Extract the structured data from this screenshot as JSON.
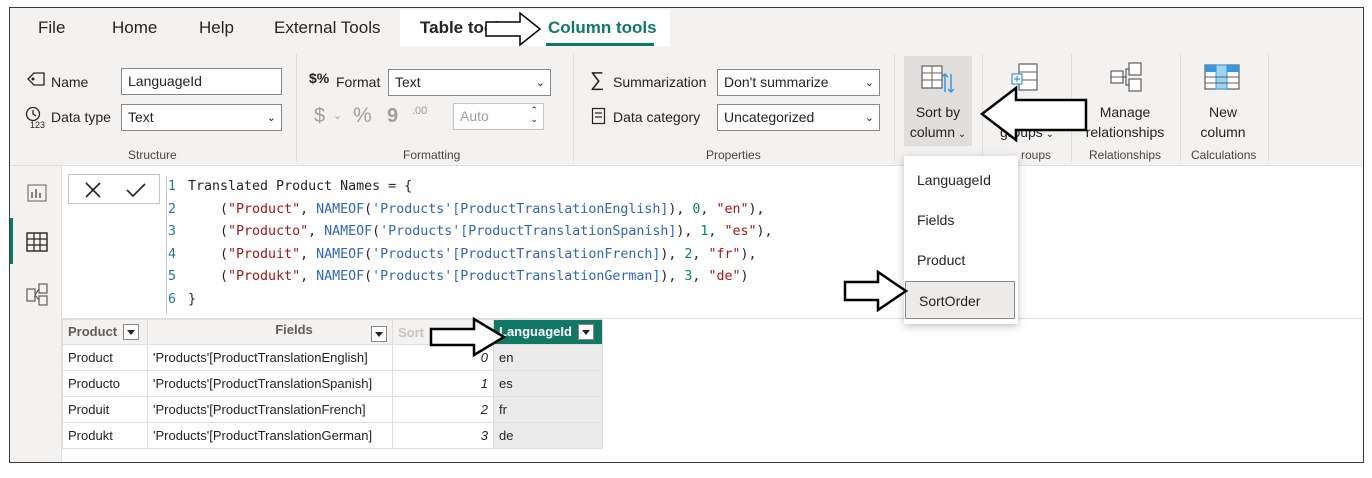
{
  "tabs": {
    "file": "File",
    "home": "Home",
    "help": "Help",
    "external_tools": "External Tools",
    "table_tools": "Table tools",
    "column_tools": "Column tools"
  },
  "structure": {
    "name_label": "Name",
    "name_value": "LanguageId",
    "datatype_label": "Data type",
    "datatype_value": "Text",
    "group_label": "Structure"
  },
  "formatting": {
    "format_label": "Format",
    "format_value": "Text",
    "currency_symbol": "$",
    "percent_symbol": "%",
    "comma_symbol": "9",
    "decimals_symbol": ".00",
    "auto_value": "Auto",
    "group_label": "Formatting"
  },
  "properties": {
    "summarization_label": "Summarization",
    "summarization_value": "Don't summarize",
    "category_label": "Data category",
    "category_value": "Uncategorized",
    "group_label": "Properties"
  },
  "sort_by": {
    "line1": "Sort by",
    "line2": "column"
  },
  "groups_btn": {
    "line2": "groups"
  },
  "groups_group_label": "roups",
  "manage_rel": {
    "line1": "Manage",
    "line2": "relationships",
    "group_label": "Relationships"
  },
  "new_column": {
    "line1": "New",
    "line2": "column",
    "group_label": "Calculations"
  },
  "dropdown_menu": [
    "LanguageId",
    "Fields",
    "Product",
    "SortOrder"
  ],
  "formula": {
    "line_numbers": [
      "1",
      "2",
      "3",
      "4",
      "5",
      "6"
    ],
    "line1": "Translated Product Names = {",
    "rows": [
      {
        "str1": "\"Product\"",
        "fn": "NAMEOF",
        "arg": "'Products'[ProductTranslationEnglish]",
        "num": "0",
        "str2": "\"en\"",
        "end": "),"
      },
      {
        "str1": "\"Producto\"",
        "fn": "NAMEOF",
        "arg": "'Products'[ProductTranslationSpanish]",
        "num": "1",
        "str2": "\"es\"",
        "end": "),"
      },
      {
        "str1": "\"Produit\"",
        "fn": "NAMEOF",
        "arg": "'Products'[ProductTranslationFrench]",
        "num": "2",
        "str2": "\"fr\"",
        "end": "),"
      },
      {
        "str1": "\"Produkt\"",
        "fn": "NAMEOF",
        "arg": "'Products'[ProductTranslationGerman]",
        "num": "3",
        "str2": "\"de\"",
        "end": ")"
      }
    ],
    "line6": "}"
  },
  "table": {
    "headers": [
      "Product",
      "Fields",
      "Sort",
      "LanguageId"
    ],
    "rows": [
      [
        "Product",
        "'Products'[ProductTranslationEnglish]",
        "0",
        "en"
      ],
      [
        "Producto",
        "'Products'[ProductTranslationSpanish]",
        "1",
        "es"
      ],
      [
        "Produit",
        "'Products'[ProductTranslationFrench]",
        "2",
        "fr"
      ],
      [
        "Produkt",
        "'Products'[ProductTranslationGerman]",
        "3",
        "de"
      ]
    ]
  },
  "colors": {
    "accent": "#117865",
    "ribbon_bg": "#f3f2f1"
  }
}
